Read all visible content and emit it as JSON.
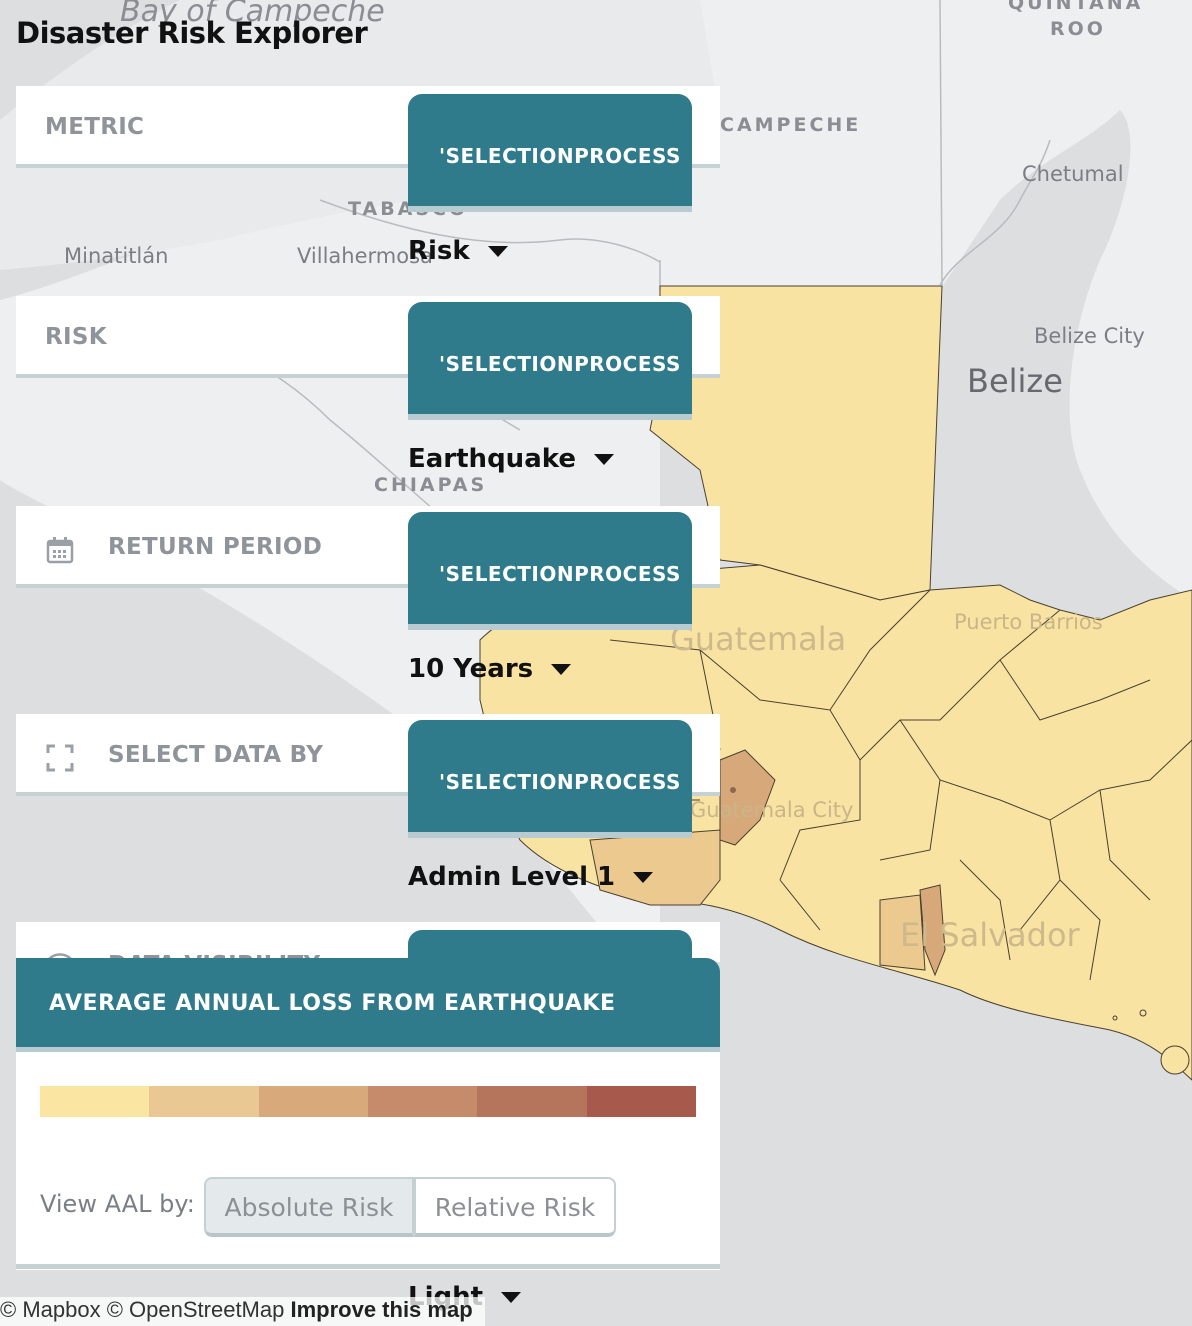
{
  "app": {
    "title": "Disaster Risk Explorer"
  },
  "map_labels": {
    "gulf": "Bay of Campeche",
    "quintana_roo_1": "QUINTANA",
    "quintana_roo_2": "ROO",
    "campeche": "CAMPECHE",
    "chetumal": "Chetumal",
    "tabasco": "TABASCO",
    "minatitlan": "Minatitlán",
    "villahermosa": "Villahermosa",
    "belize_city": "Belize City",
    "belize": "Belize",
    "chiapas": "CHIAPAS",
    "puerto_barrios": "Puerto Barrios",
    "guatemala": "Guatemala",
    "guatemala_city": "Guatemala City",
    "el_salvador": "El Salvador"
  },
  "controls": {
    "metric": {
      "label": "METRIC",
      "tab": "'SELECTIONPROCESS",
      "value": "Risk"
    },
    "risk": {
      "label": "RISK",
      "tab": "'SELECTIONPROCESS",
      "value": "Earthquake"
    },
    "return_period": {
      "label": "RETURN PERIOD",
      "tab": "'SELECTIONPROCESS",
      "value": "10 Years",
      "icon": "calendar-icon"
    },
    "select_by": {
      "label": "SELECT DATA BY",
      "tab": "'SELECTIONPROCESS",
      "value": "Admin Level 1",
      "icon": "select-region-icon"
    },
    "visibility": {
      "label": "DATA VISIBILITY",
      "value": "Light",
      "icon": "eye-icon"
    }
  },
  "legend": {
    "title": "AVERAGE ANNUAL LOSS FROM EARTHQUAKE",
    "ramp_colors": [
      "#fae5a3",
      "#eac893",
      "#d8a97b",
      "#c68b6a",
      "#b5755d",
      "#a75a4b"
    ],
    "view_by_label": "View AAL by:",
    "absolute_label": "Absolute Risk",
    "relative_label": "Relative Risk",
    "selected": "Absolute Risk"
  },
  "attribution": {
    "mapbox": "© Mapbox",
    "osm": "© OpenStreetMap",
    "improve": "Improve this map"
  },
  "colors": {
    "accent": "#2f7a8b",
    "region_low": "#f9e3a2",
    "region_mid": "#ebc98f",
    "region_high": "#d7a97a"
  }
}
